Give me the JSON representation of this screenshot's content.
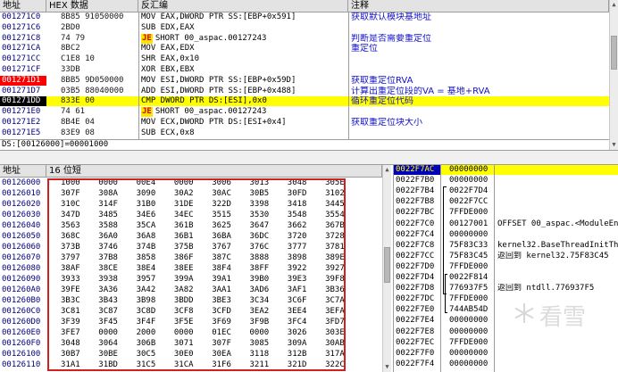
{
  "disasm": {
    "headers": {
      "addr": "地址",
      "hex": "HEX 数据",
      "asm": "反汇编",
      "comment": "注释"
    },
    "rows": [
      {
        "addr": "001271C0",
        "hex": "8B85 91050000",
        "asm": "MOV EAX,DWORD PTR SS:[EBP+0x591]",
        "comment": "获取默认模块基地址"
      },
      {
        "addr": "001271C6",
        "hex": "2BD0",
        "asm": "SUB EDX,EAX",
        "comment": ""
      },
      {
        "addr": "001271C8",
        "hex": "74 79",
        "jump": "JE",
        "asm": "SHORT 00_aspac.00127243",
        "comment": "判断是否需要重定位"
      },
      {
        "addr": "001271CA",
        "hex": "8BC2",
        "asm": "MOV EAX,EDX",
        "comment": "重定位"
      },
      {
        "addr": "001271CC",
        "hex": "C1E8 10",
        "asm": "SHR EAX,0x10",
        "comment": ""
      },
      {
        "addr": "001271CF",
        "hex": "33DB",
        "asm": "XOR EBX,EBX",
        "comment": ""
      },
      {
        "addr": "001271D1",
        "hex": "8BB5 9D050000",
        "asm": "MOV ESI,DWORD PTR SS:[EBP+0x59D]",
        "comment": "获取重定位RVA"
      },
      {
        "addr": "001271D7",
        "hex": "03B5 88040000",
        "asm": "ADD ESI,DWORD PTR SS:[EBP+0x488]",
        "comment": "计算出重定位段的VA = 基地+RVA"
      },
      {
        "addr": "001271DD",
        "hex": "833E 00",
        "asm": "CMP DWORD PTR DS:[ESI],0x0",
        "comment": "循环重定位代码"
      },
      {
        "addr": "001271E0",
        "hex": "74 61",
        "jump": "JE",
        "asm": "SHORT 00_aspac.00127243",
        "comment": ""
      },
      {
        "addr": "001271E2",
        "hex": "8B4E 04",
        "asm": "MOV ECX,DWORD PTR DS:[ESI+0x4]",
        "comment": "获取重定位块大小"
      },
      {
        "addr": "001271E5",
        "hex": "83E9 08",
        "asm": "SUB ECX,0x8",
        "comment": ""
      }
    ],
    "info_line": "DS:[00126000]=00001000"
  },
  "dump": {
    "headers": {
      "addr": "地址",
      "hex": "16 位短"
    },
    "rows": [
      {
        "addr": "00126000",
        "v": [
          "1000",
          "0000",
          "00E4",
          "0000",
          "3006",
          "3013",
          "3048",
          "305E"
        ]
      },
      {
        "addr": "00126010",
        "v": [
          "307F",
          "308A",
          "3090",
          "30A2",
          "30AC",
          "30B5",
          "30FD",
          "3102"
        ]
      },
      {
        "addr": "00126020",
        "v": [
          "310C",
          "314F",
          "31B0",
          "31DE",
          "322D",
          "3398",
          "3418",
          "3445"
        ]
      },
      {
        "addr": "00126030",
        "v": [
          "347D",
          "3485",
          "34E6",
          "34EC",
          "3515",
          "3530",
          "3548",
          "3554"
        ]
      },
      {
        "addr": "00126040",
        "v": [
          "3563",
          "3588",
          "35CA",
          "361B",
          "3625",
          "3647",
          "3662",
          "367B"
        ]
      },
      {
        "addr": "00126050",
        "v": [
          "368C",
          "36A0",
          "36A8",
          "36B1",
          "36BA",
          "36DC",
          "3720",
          "3728"
        ]
      },
      {
        "addr": "00126060",
        "v": [
          "373B",
          "3746",
          "374B",
          "375B",
          "3767",
          "376C",
          "3777",
          "3781"
        ]
      },
      {
        "addr": "00126070",
        "v": [
          "3797",
          "37B8",
          "3858",
          "386F",
          "387C",
          "3888",
          "3898",
          "389E"
        ]
      },
      {
        "addr": "00126080",
        "v": [
          "38AF",
          "38CE",
          "38E4",
          "38EE",
          "38F4",
          "38FF",
          "3922",
          "3927"
        ]
      },
      {
        "addr": "00126090",
        "v": [
          "3933",
          "3938",
          "3957",
          "399A",
          "39A1",
          "39B0",
          "39E3",
          "39F8"
        ]
      },
      {
        "addr": "001260A0",
        "v": [
          "39FE",
          "3A36",
          "3A42",
          "3A82",
          "3AA1",
          "3AD6",
          "3AF1",
          "3B36"
        ]
      },
      {
        "addr": "001260B0",
        "v": [
          "3B3C",
          "3B43",
          "3B98",
          "3BDD",
          "3BE3",
          "3C34",
          "3C6F",
          "3C7A"
        ]
      },
      {
        "addr": "001260C0",
        "v": [
          "3C81",
          "3C87",
          "3C8D",
          "3CF8",
          "3CFD",
          "3EA2",
          "3EE4",
          "3EFA"
        ]
      },
      {
        "addr": "001260D0",
        "v": [
          "3F39",
          "3F45",
          "3F4F",
          "3F5E",
          "3F69",
          "3F9B",
          "3FC4",
          "3FD7"
        ]
      },
      {
        "addr": "001260E0",
        "v": [
          "3FE7",
          "0000",
          "2000",
          "0000",
          "01EC",
          "0000",
          "3026",
          "303E"
        ]
      },
      {
        "addr": "001260F0",
        "v": [
          "3048",
          "3064",
          "306B",
          "3071",
          "307F",
          "3085",
          "309A",
          "30AB"
        ]
      },
      {
        "addr": "00126100",
        "v": [
          "30B7",
          "30BE",
          "30C5",
          "30E0",
          "30EA",
          "3118",
          "312B",
          "317A"
        ]
      },
      {
        "addr": "00126110",
        "v": [
          "31A1",
          "31BD",
          "31C5",
          "31CA",
          "31F6",
          "3211",
          "321D",
          "322C"
        ]
      }
    ]
  },
  "stack": {
    "rows": [
      {
        "addr": "0022F7AC",
        "val": "00000000",
        "note": ""
      },
      {
        "addr": "0022F7B0",
        "val": "00000000",
        "note": ""
      },
      {
        "addr": "0022F7B4",
        "val": "0022F7D4",
        "note": ""
      },
      {
        "addr": "0022F7B8",
        "val": "0022F7CC",
        "note": ""
      },
      {
        "addr": "0022F7BC",
        "val": "7FFDE000",
        "note": ""
      },
      {
        "addr": "0022F7C0",
        "val": "00127001",
        "note": "OFFSET 00_aspac.<ModuleEntryPoint>"
      },
      {
        "addr": "0022F7C4",
        "val": "00000000",
        "note": ""
      },
      {
        "addr": "0022F7C8",
        "val": "75F83C33",
        "note": "kernel32.BaseThreadInitThunk"
      },
      {
        "addr": "0022F7CC",
        "val": "75F83C45",
        "note": "返回到 kernel32.75F83C45"
      },
      {
        "addr": "0022F7D0",
        "val": "7FFDE000",
        "note": ""
      },
      {
        "addr": "0022F7D4",
        "val": "0022F814",
        "note": ""
      },
      {
        "addr": "0022F7D8",
        "val": "776937F5",
        "note": "返回到 ntdll.776937F5"
      },
      {
        "addr": "0022F7DC",
        "val": "7FFDE000",
        "note": ""
      },
      {
        "addr": "0022F7E0",
        "val": "744AB54D",
        "note": ""
      },
      {
        "addr": "0022F7E4",
        "val": "00000000",
        "note": ""
      },
      {
        "addr": "0022F7E8",
        "val": "00000000",
        "note": ""
      },
      {
        "addr": "0022F7EC",
        "val": "7FFDE000",
        "note": ""
      },
      {
        "addr": "0022F7F0",
        "val": "00000000",
        "note": ""
      },
      {
        "addr": "0022F7F4",
        "val": "00000000",
        "note": ""
      }
    ]
  },
  "watermark": "看雪",
  "colors": {
    "selected": "#ffff00",
    "breakpoint": "#ff0000",
    "comment": "#1212c8",
    "jump_bg": "#ffe400",
    "jump_fg": "#d40000",
    "dump_border": "#d02020"
  }
}
